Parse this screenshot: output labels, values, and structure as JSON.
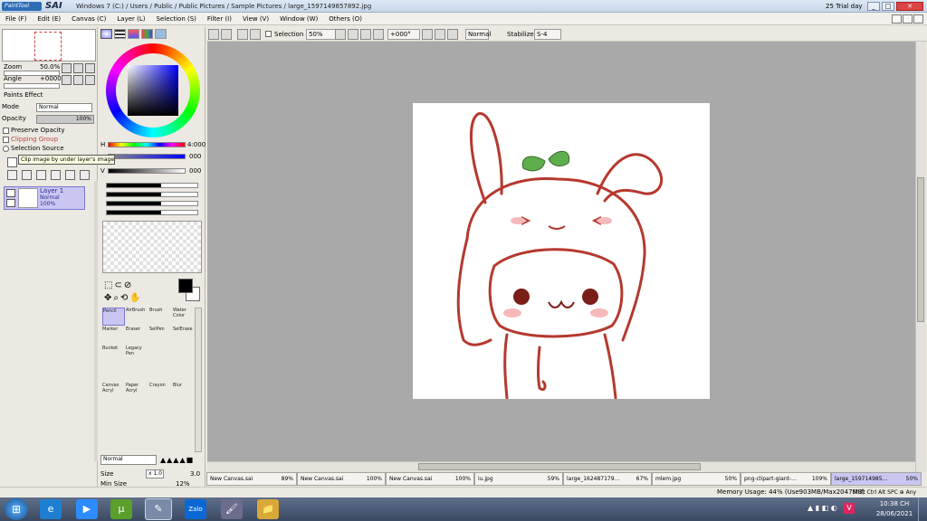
{
  "window": {
    "app": "PaintTool",
    "brand": "SAI",
    "title": "Windows 7 (C:) / Users / Public / Public Pictures / Sample Pictures / large_1597149857892.jpg",
    "trial": "25 Trial day",
    "min": "_",
    "max": "□",
    "close": "✕"
  },
  "menu": [
    "File (F)",
    "Edit (E)",
    "Canvas (C)",
    "Layer (L)",
    "Selection (S)",
    "Filter (I)",
    "View (V)",
    "Window (W)",
    "Others (O)"
  ],
  "toolbar": {
    "selection_label": "Selection",
    "zoom": "50%",
    "angle": "+000°",
    "blend": "Normal",
    "stabilizer_label": "Stabilizer",
    "stabilizer": "S-4"
  },
  "navigator": {
    "zoom_label": "Zoom",
    "zoom": "50.0%",
    "angle_label": "Angle",
    "angle": "+0000"
  },
  "layer_props": {
    "paint_effect": "Paints Effect",
    "mode_label": "Mode",
    "mode": "Normal",
    "opacity_label": "Opacity",
    "opacity": "100%",
    "preserve": "Preserve Opacity",
    "clipping": "Clipping Group",
    "selection_source": "Selection Source"
  },
  "tooltip": "Clip image by under layer's image",
  "layer": {
    "name": "Layer 1",
    "mode": "Normal",
    "opacity": "100%"
  },
  "color": {
    "h_label": "H",
    "h_value": "4:000",
    "s_value": "000",
    "v_label": "V",
    "v_value": "000"
  },
  "tools": {
    "pencil": "Pencil",
    "airbrush": "AirBrush",
    "brush": "Brush",
    "water": "Water Color",
    "marker": "Marker",
    "eraser": "Eraser",
    "selpen": "SelPen",
    "seleras": "SelErase",
    "bucket": "Bucket",
    "legacy": "Legacy Pen",
    "canvas_acry": "Canvas Acryl",
    "paper_acry": "Paper Acryl",
    "crayon": "Crayon",
    "blur": "Blur"
  },
  "brush": {
    "mode": "Normal",
    "size_label": "Size",
    "size_mult": "x 1.0",
    "size": "3.0",
    "minsize_label": "Min Size",
    "minsize": "12%"
  },
  "doc_tabs": [
    {
      "name": "New Canvas.sai",
      "zoom": "89%"
    },
    {
      "name": "New Canvas.sai",
      "zoom": "100%"
    },
    {
      "name": "New Canvas.sai",
      "zoom": "100%"
    },
    {
      "name": "iu.jpg",
      "zoom": "59%"
    },
    {
      "name": "large_162487179...",
      "zoom": "67%"
    },
    {
      "name": "mlem.jpg",
      "zoom": "50%"
    },
    {
      "name": "png-clipart-giant-...",
      "zoom": "109%"
    },
    {
      "name": "large_159714985...",
      "zoom": "50%"
    }
  ],
  "status": {
    "memory": "Memory Usage: 44% (Use903MB/Max2047MB)",
    "keys": "Shift Ctrl Alt SPC ⊕ Any"
  },
  "taskbar": {
    "time": "10:38 CH",
    "date": "28/06/2021",
    "zalo": "Zalo"
  },
  "colors": {
    "accent": "#c9c7f2",
    "canvas_bg": "#a9a9a9",
    "outline": "#b5392e"
  }
}
